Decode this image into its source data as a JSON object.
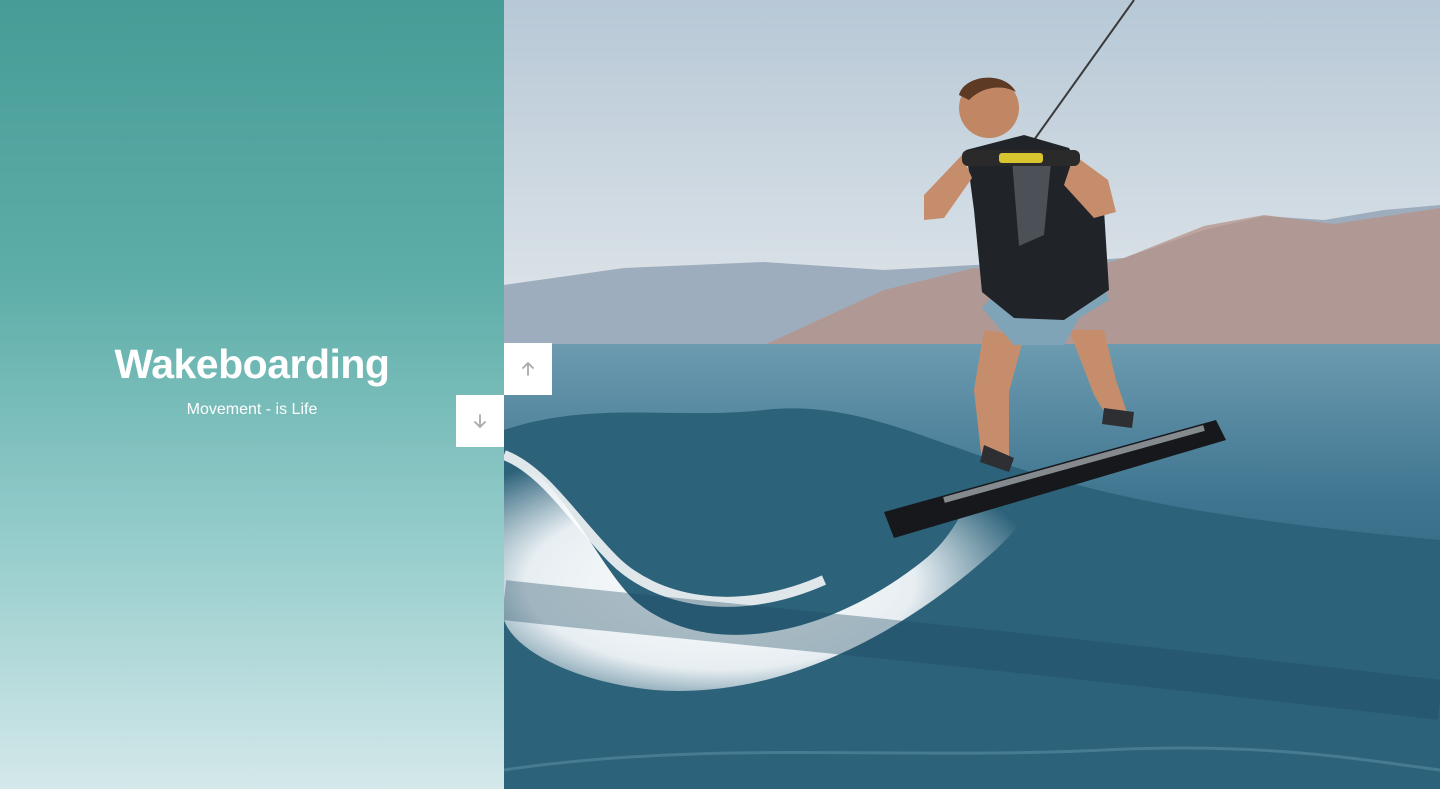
{
  "slide": {
    "title": "Wakeboarding",
    "subtitle": "Movement - is Life"
  },
  "controls": {
    "up_icon": "arrow-up-icon",
    "down_icon": "arrow-down-icon"
  },
  "colors": {
    "gradient_top": "#479c97",
    "gradient_bottom": "#d4e8ea",
    "text": "#ffffff",
    "button_bg": "#ffffff",
    "button_icon": "#aaaaaa"
  }
}
